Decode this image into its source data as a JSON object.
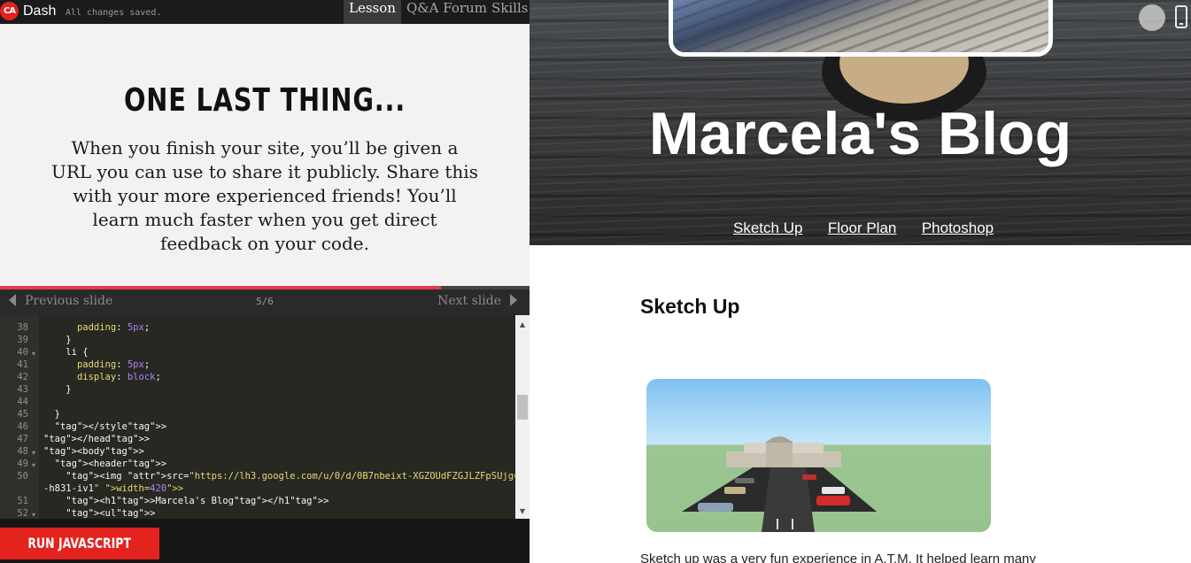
{
  "topbar": {
    "logo": "CA",
    "app_name": "Dash",
    "save_status": "All changes saved.",
    "tabs": [
      {
        "label": "Lesson",
        "active": true
      },
      {
        "label": "Q&A Forum",
        "active": false
      },
      {
        "label": "Skills",
        "active": false
      }
    ]
  },
  "lesson": {
    "title": "ONE LAST THING...",
    "body": "When you finish your site, you’ll be given a URL you can use to share it publicly. Share this with your more experienced friends! You’ll learn much faster when you get direct feedback on your code."
  },
  "slides": {
    "prev_label": "Previous slide",
    "next_label": "Next slide",
    "counter": "5/6",
    "progress_fraction": 0.833
  },
  "editor": {
    "lines": [
      {
        "n": "38",
        "code": "      padding: 5px;"
      },
      {
        "n": "39",
        "code": "    }"
      },
      {
        "n": "40",
        "code": "    li {"
      },
      {
        "n": "41",
        "code": "      padding: 5px;"
      },
      {
        "n": "42",
        "code": "      display: block;"
      },
      {
        "n": "43",
        "code": "    }"
      },
      {
        "n": "44",
        "code": ""
      },
      {
        "n": "45",
        "code": "  }"
      },
      {
        "n": "46",
        "code": "  </style>"
      },
      {
        "n": "47",
        "code": "</head>"
      },
      {
        "n": "48",
        "code": "<body>"
      },
      {
        "n": "49",
        "code": "  <header>"
      },
      {
        "n": "50",
        "code": "    <img src=\"https://lh3.google.com/u/0/d/0B7nbeixt-XGZOUdFZGJLZFpSUjg=w1920"
      },
      {
        "n": "",
        "code": "-h831-iv1\" width=420>"
      },
      {
        "n": "51",
        "code": "    <h1>Marcela's Blog</h1>"
      },
      {
        "n": "52",
        "code": "    <ul>"
      }
    ]
  },
  "run_button": {
    "label": "RUN JAVASCRIPT"
  },
  "preview": {
    "blog_title": "Marcela's Blog",
    "nav": [
      "Sketch Up",
      "Floor Plan",
      "Photoshop"
    ],
    "section_title": "Sketch Up",
    "excerpt": "Sketch up was a very fun experience in A.T.M. It helped learn many"
  },
  "colors": {
    "accent_red": "#e4221e",
    "progress_pink": "#e83a4c",
    "editor_bg": "#272822"
  }
}
